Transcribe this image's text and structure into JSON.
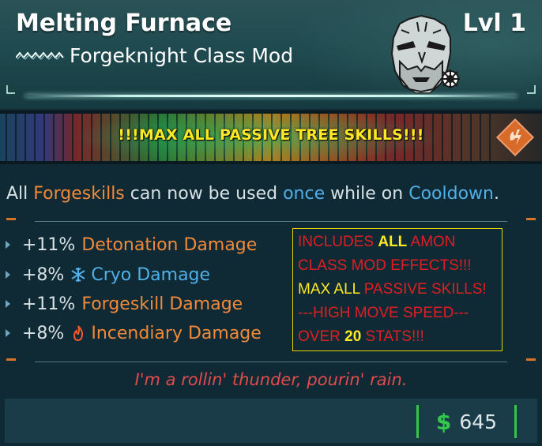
{
  "header": {
    "title": "Melting Furnace",
    "subtitle": "Forgeknight Class Mod",
    "level": "Lvl 1"
  },
  "banner": "!!!MAX ALL PASSIVE TREE SKILLS!!!",
  "description": {
    "p1": "All ",
    "forgeskills": "Forgeskills",
    "p2": " can now be used ",
    "once": "once",
    "p3": " while on ",
    "cooldown": "Cooldown",
    "p4": "."
  },
  "stats": [
    {
      "value": "+11%",
      "name": "Detonation Damage",
      "color": "#f08a3a",
      "icon": "none"
    },
    {
      "value": "+8%",
      "name": "Cryo Damage",
      "color": "#4fb0e8",
      "icon": "snowflake-icon"
    },
    {
      "value": "+11%",
      "name": "Forgeskill Damage",
      "color": "#f08a3a",
      "icon": "none"
    },
    {
      "value": "+8%",
      "name": "Incendiary Damage",
      "color": "#f08a3a",
      "icon": "flame-icon"
    }
  ],
  "callout": {
    "l1a": "INCLUDES ",
    "l1b": "ALL",
    "l1c": " AMON",
    "l2": "CLASS MOD EFFECTS!!!",
    "l3a": "MAX ALL ",
    "l3b": "PASSIVE SKILLS!",
    "l4": "---HIGH MOVE SPEED---",
    "l5a": "OVER ",
    "l5b": "20",
    "l5c": " STATS!!!"
  },
  "flavor_text": "I'm a rollin' thunder, pourin' rain.",
  "price": {
    "currency_symbol": "$",
    "amount": "645"
  },
  "colors": {
    "banner_text": "#ffe826",
    "orange": "#f08a3a",
    "blue": "#4fb0e8",
    "callout_red": "#e01e22",
    "price_green": "#33c94c"
  }
}
